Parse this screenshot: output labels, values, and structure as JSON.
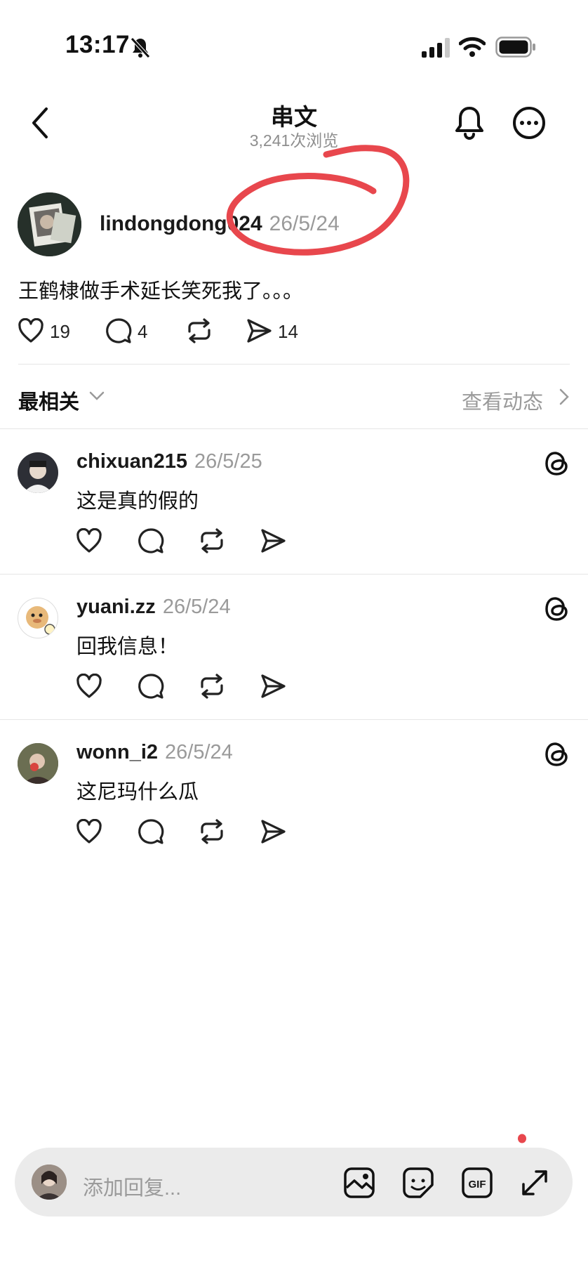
{
  "status_bar": {
    "time": "13:17"
  },
  "header": {
    "title": "串文",
    "views": "3,241次浏览"
  },
  "post": {
    "username": "lindongdong024",
    "date": "26/5/24",
    "text": "王鹤棣做手术延长笑死我了。。。",
    "likes": "19",
    "comments": "4",
    "shares": "14"
  },
  "sort": {
    "label": "最相关",
    "activity_link": "查看动态"
  },
  "comments": [
    {
      "username": "chixuan215",
      "date": "26/5/25",
      "text": "这是真的假的"
    },
    {
      "username": "yuani.zz",
      "date": "26/5/24",
      "text": "回我信息！"
    },
    {
      "username": "wonn_i2",
      "date": "26/5/24",
      "text": "这尼玛什么瓜"
    }
  ],
  "reply": {
    "placeholder": "添加回复..."
  },
  "colors": {
    "annotation": "#e8474d",
    "muted": "#9a9a9a"
  },
  "icons": [
    "back-arrow-icon",
    "bell-icon",
    "more-icon",
    "heart-icon",
    "comment-icon",
    "repost-icon",
    "send-icon",
    "chevron-down-icon",
    "chevron-right-icon",
    "threads-icon",
    "image-icon",
    "sticker-icon",
    "gif-icon",
    "expand-icon"
  ]
}
